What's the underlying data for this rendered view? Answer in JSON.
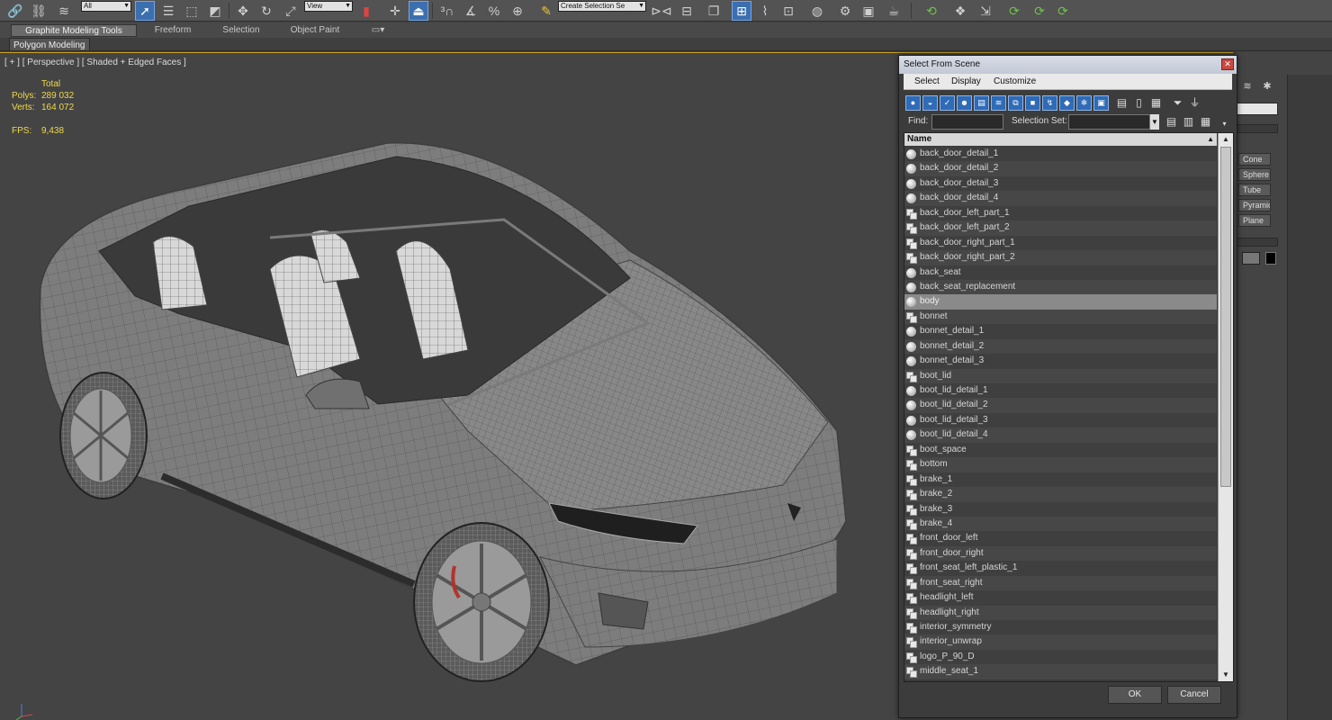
{
  "toolbar": {
    "filter_dropdown": "All",
    "ref_coord_dropdown": "View",
    "selection_set_dropdown": "Create Selection Se"
  },
  "ribbon": {
    "tabs": [
      "Graphite Modeling Tools",
      "Freeform",
      "Selection",
      "Object Paint"
    ],
    "panel_label": "Polygon Modeling"
  },
  "viewport": {
    "label": "[ + ] [ Perspective ] [ Shaded + Edged Faces ]",
    "stats": {
      "total_label": "Total",
      "polys_label": "Polys:",
      "polys_value": "289 032",
      "verts_label": "Verts:",
      "verts_value": "164 072",
      "fps_label": "FPS:",
      "fps_value": "9,438"
    }
  },
  "command_panel": {
    "buttons": [
      "Cone",
      "Sphere",
      "Tube",
      "Pyramid",
      "Plane"
    ]
  },
  "dialog": {
    "title": "Select From Scene",
    "close_glyph": "✕",
    "menu": [
      "Select",
      "Display",
      "Customize"
    ],
    "find_label": "Find:",
    "find_value": "",
    "selection_set_label": "Selection Set:",
    "selection_set_value": "",
    "column_header": "Name",
    "ok_label": "OK",
    "cancel_label": "Cancel",
    "items": [
      {
        "name": "back_door_detail_1",
        "icon": "sphere"
      },
      {
        "name": "back_door_detail_2",
        "icon": "sphere"
      },
      {
        "name": "back_door_detail_3",
        "icon": "sphere"
      },
      {
        "name": "back_door_detail_4",
        "icon": "sphere"
      },
      {
        "name": "back_door_left_part_1",
        "icon": "group"
      },
      {
        "name": "back_door_left_part_2",
        "icon": "group"
      },
      {
        "name": "back_door_right_part_1",
        "icon": "group"
      },
      {
        "name": "back_door_right_part_2",
        "icon": "group"
      },
      {
        "name": "back_seat",
        "icon": "sphere"
      },
      {
        "name": "back_seat_replacement",
        "icon": "sphere"
      },
      {
        "name": "body",
        "icon": "sphere",
        "selected": true
      },
      {
        "name": "bonnet",
        "icon": "group"
      },
      {
        "name": "bonnet_detail_1",
        "icon": "sphere"
      },
      {
        "name": "bonnet_detail_2",
        "icon": "sphere"
      },
      {
        "name": "bonnet_detail_3",
        "icon": "sphere"
      },
      {
        "name": "boot_lid",
        "icon": "group"
      },
      {
        "name": "boot_lid_detail_1",
        "icon": "sphere"
      },
      {
        "name": "boot_lid_detail_2",
        "icon": "sphere"
      },
      {
        "name": "boot_lid_detail_3",
        "icon": "sphere"
      },
      {
        "name": "boot_lid_detail_4",
        "icon": "sphere"
      },
      {
        "name": "boot_space",
        "icon": "group"
      },
      {
        "name": "bottom",
        "icon": "group"
      },
      {
        "name": "brake_1",
        "icon": "group"
      },
      {
        "name": "brake_2",
        "icon": "group"
      },
      {
        "name": "brake_3",
        "icon": "group"
      },
      {
        "name": "brake_4",
        "icon": "group"
      },
      {
        "name": "front_door_left",
        "icon": "group"
      },
      {
        "name": "front_door_right",
        "icon": "group"
      },
      {
        "name": "front_seat_left_plastic_1",
        "icon": "group"
      },
      {
        "name": "front_seat_right",
        "icon": "group"
      },
      {
        "name": "headlight_left",
        "icon": "group"
      },
      {
        "name": "headlight_right",
        "icon": "group"
      },
      {
        "name": "interior_symmetry",
        "icon": "group"
      },
      {
        "name": "interior_unwrap",
        "icon": "group"
      },
      {
        "name": "logo_P_90_D",
        "icon": "group"
      },
      {
        "name": "middle_seat_1",
        "icon": "group"
      }
    ]
  }
}
